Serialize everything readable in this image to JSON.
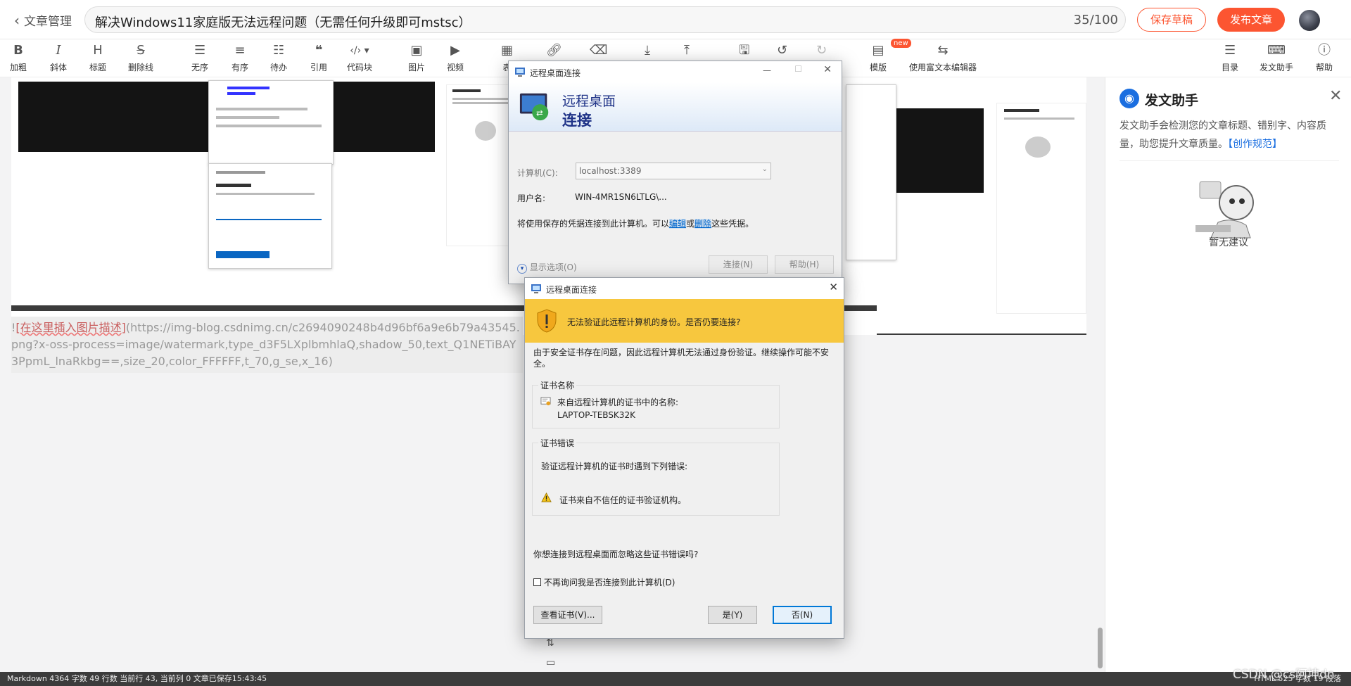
{
  "header": {
    "back_label": "文章管理",
    "title": "解决Windows11家庭版无法远程问题（无需任何升级即可mstsc）",
    "title_count": "35/100",
    "save_draft": "保存草稿",
    "publish": "发布文章"
  },
  "toolbar": {
    "bold": "加粗",
    "italic": "斜体",
    "heading": "标题",
    "strike": "删除线",
    "unordered": "无序",
    "ordered": "有序",
    "todo": "待办",
    "quote": "引用",
    "codeblock": "代码块",
    "image": "图片",
    "video": "视频",
    "table": "表",
    "template": "模版",
    "template_badge": "new",
    "rich_editor": "使用富文本编辑器",
    "toc": "目录",
    "assistant": "发文助手",
    "help": "帮助"
  },
  "editor": {
    "md_link_prefix": "!",
    "md_link_red": "[在这里插入图片描述]",
    "md_link_rest": "(https://img-blog.csdnimg.cn/c2694090248b4d96bf6a9e6b79a43545.png?x-oss-process=image/watermark,type_d3F5LXplbmhlaQ,shadow_50,text_Q1NETiBAY3PpmL_lnaRkbg==,size_20,color_FFFFFF,t_70,g_se,x_16)"
  },
  "rdp_main": {
    "window_title": "远程桌面连接",
    "banner_line1": "远程桌面",
    "banner_line2": "连接",
    "computer_label": "计算机(C):",
    "computer_value": "localhost:3389",
    "username_label": "用户名:",
    "username_value": "WIN-4MR1SN6LTLG\\...",
    "saved_cred_text1": "将使用保存的凭据连接到此计算机。可以",
    "edit_link": "编辑",
    "or_text": "或",
    "delete_link": "删除",
    "saved_cred_text2": "这些凭据。",
    "show_options": "显示选项(O)",
    "connect": "连接(N)",
    "help": "帮助(H)"
  },
  "cert_dialog": {
    "window_title": "远程桌面连接",
    "warning_header": "无法验证此远程计算机的身份。是否仍要连接?",
    "security_text": "由于安全证书存在问题，因此远程计算机无法通过身份验证。继续操作可能不安全。",
    "cert_name_group": "证书名称",
    "cert_name_line1": "来自远程计算机的证书中的名称:",
    "cert_name_value": "LAPTOP-TEBSK32K",
    "cert_error_group": "证书错误",
    "cert_error_intro": "验证远程计算机的证书时遇到下列错误:",
    "cert_error_item": "证书来自不信任的证书验证机构。",
    "question": "你想连接到远程桌面而忽略这些证书错误吗?",
    "dont_ask": "不再询问我是否连接到此计算机(D)",
    "view_cert": "查看证书(V)...",
    "yes": "是(Y)",
    "no": "否(N)"
  },
  "right_panel": {
    "title": "发文助手",
    "desc": "发文助手会检测您的文章标题、错别字、内容质量，助您提升文章质量。",
    "link": "【创作规范】",
    "none": "暂无建议"
  },
  "status": {
    "left": "Markdown  4364 字数  49 行数  当前行 43, 当前列 0  文章已保存15:43:45",
    "right": "HTML  525 字数  19 段落",
    "watermark": "CSDN @cs阿坤dn"
  },
  "colors": {
    "brand": "#fc5531",
    "warning_banner": "#f7c73e",
    "link": "#1a6ee0"
  }
}
